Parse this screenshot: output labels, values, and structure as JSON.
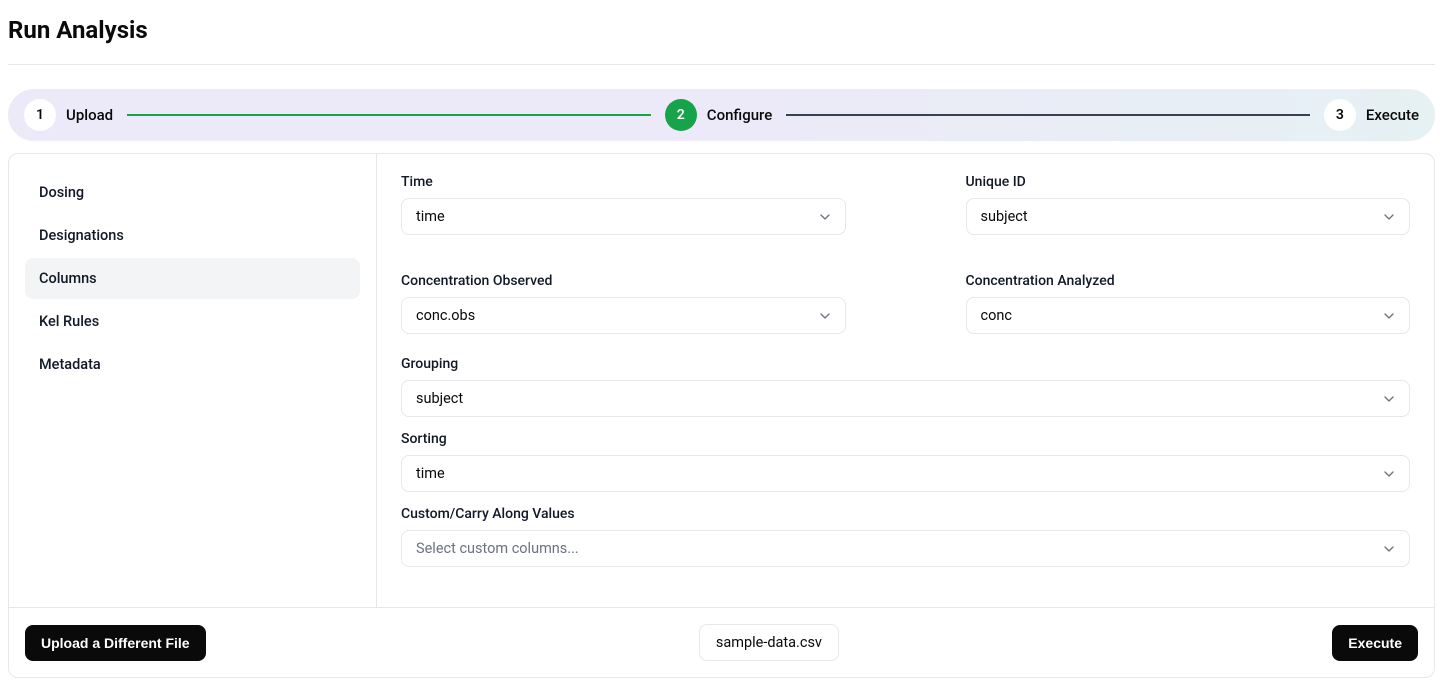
{
  "page_title": "Run Analysis",
  "stepper": {
    "steps": [
      {
        "num": "1",
        "label": "Upload",
        "active": false
      },
      {
        "num": "2",
        "label": "Configure",
        "active": true
      },
      {
        "num": "3",
        "label": "Execute",
        "active": false
      }
    ]
  },
  "sidebar": {
    "items": [
      {
        "label": "Dosing",
        "active": false
      },
      {
        "label": "Designations",
        "active": false
      },
      {
        "label": "Columns",
        "active": true
      },
      {
        "label": "Kel Rules",
        "active": false
      },
      {
        "label": "Metadata",
        "active": false
      }
    ]
  },
  "fields": {
    "time": {
      "label": "Time",
      "value": "time"
    },
    "unique_id": {
      "label": "Unique ID",
      "value": "subject"
    },
    "conc_obs": {
      "label": "Concentration Observed",
      "value": "conc.obs"
    },
    "conc_ana": {
      "label": "Concentration Analyzed",
      "value": "conc"
    },
    "grouping": {
      "label": "Grouping",
      "value": "subject"
    },
    "sorting": {
      "label": "Sorting",
      "value": "time"
    },
    "custom": {
      "label": "Custom/Carry Along Values",
      "placeholder": "Select custom columns..."
    }
  },
  "footer": {
    "upload_label": "Upload a Different File",
    "file_name": "sample-data.csv",
    "execute_label": "Execute"
  }
}
